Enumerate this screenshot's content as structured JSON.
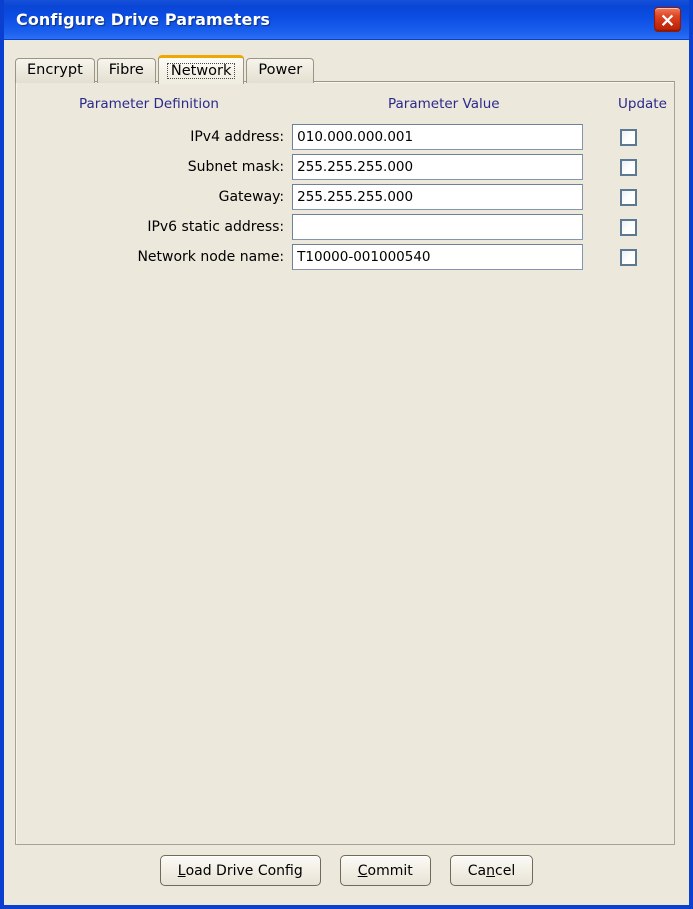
{
  "window": {
    "title": "Configure Drive Parameters",
    "close_icon": "close-x-icon",
    "accent_titlebar": "#0b4ce2",
    "accent_tab_selected": "#f0a800",
    "background": "#ece8dc",
    "header_text_color": "#2a2a8c"
  },
  "tabs": [
    {
      "label": "Encrypt",
      "selected": false
    },
    {
      "label": "Fibre",
      "selected": false
    },
    {
      "label": "Network",
      "selected": true
    },
    {
      "label": "Power",
      "selected": false
    }
  ],
  "table": {
    "headers": {
      "definition": "Parameter Definition",
      "value": "Parameter Value",
      "update": "Update"
    },
    "rows": [
      {
        "label": "IPv4 address:",
        "value": "010.000.000.001",
        "placeholder": "",
        "checked": false
      },
      {
        "label": "Subnet mask:",
        "value": "255.255.255.000",
        "placeholder": "",
        "checked": false
      },
      {
        "label": "Gateway:",
        "value": "255.255.255.000",
        "placeholder": "",
        "checked": false
      },
      {
        "label": "IPv6 static address:",
        "value": "",
        "placeholder": "",
        "checked": false
      },
      {
        "label": "Network node name:",
        "value": "T10000-001000540",
        "placeholder": "",
        "checked": false
      }
    ]
  },
  "buttons": [
    {
      "prefix": "",
      "mnemonic": "L",
      "suffix": "oad Drive Config",
      "name": "load-drive-config-button"
    },
    {
      "prefix": "",
      "mnemonic": "C",
      "suffix": "ommit",
      "name": "commit-button"
    },
    {
      "prefix": "Ca",
      "mnemonic": "n",
      "suffix": "cel",
      "name": "cancel-button"
    }
  ]
}
